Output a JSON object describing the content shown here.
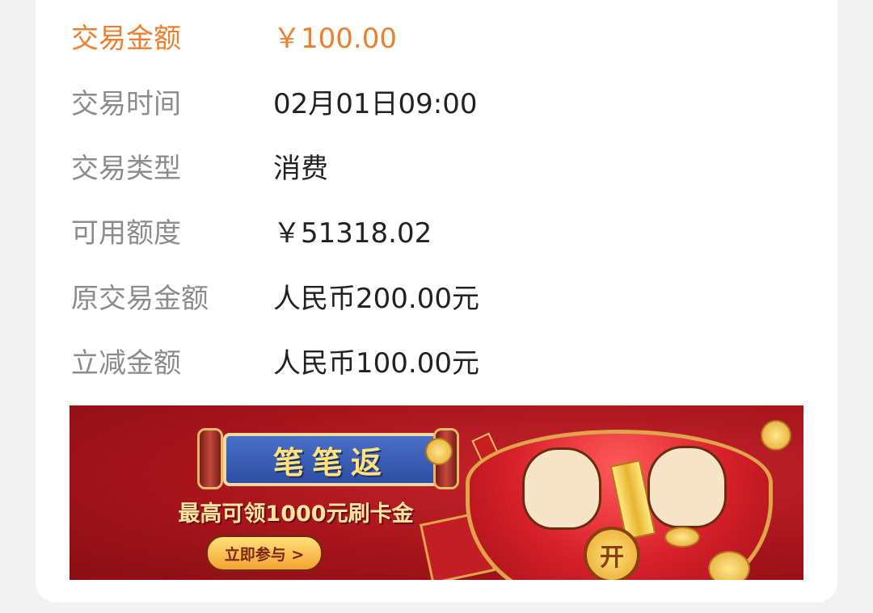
{
  "details": [
    {
      "label": "交易金额",
      "value": "￥100.00",
      "highlight": true
    },
    {
      "label": "交易时间",
      "value": "02月01日09:00"
    },
    {
      "label": "交易类型",
      "value": "消费"
    },
    {
      "label": "可用额度",
      "value": "￥51318.02"
    },
    {
      "label": "原交易金额",
      "value": "人民币200.00元"
    },
    {
      "label": "立减金额",
      "value": "人民币100.00元"
    }
  ],
  "banner": {
    "title": "笔笔返",
    "subtitle": "最高可领1000元刷卡金",
    "button_label": "立即参与 >",
    "open_label": "开"
  },
  "colors": {
    "highlight": "#ee7f2d",
    "label": "#8c8c8c",
    "value": "#222222",
    "banner_red": "#b5161e"
  }
}
